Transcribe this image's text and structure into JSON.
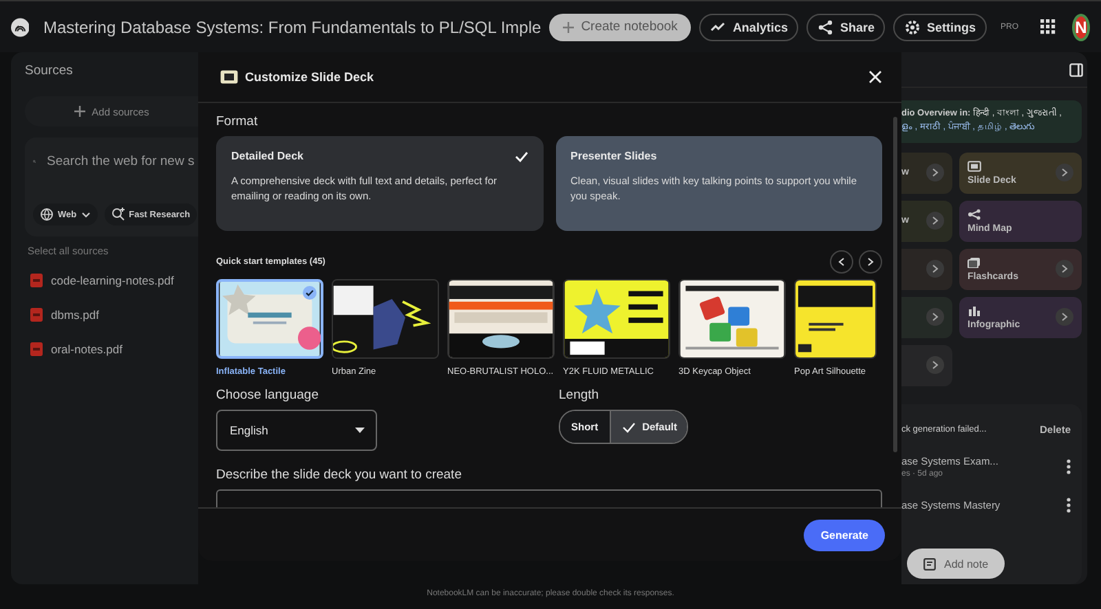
{
  "app_bar": {
    "title": "Mastering Database Systems: From Fundamentals to PL/SQL Imple",
    "create_button": "Create notebook",
    "actions": [
      {
        "label": "Analytics"
      },
      {
        "label": "Share"
      },
      {
        "label": "Settings"
      }
    ],
    "badge": "PRO",
    "avatar": "N"
  },
  "sources": {
    "title": "Sources",
    "add_button": "Add sources",
    "search": {
      "placeholder": "Search the web for new s"
    },
    "chips": [
      {
        "label": "Web"
      },
      {
        "label": "Fast Research"
      }
    ],
    "select_all": "Select all sources",
    "items": [
      {
        "name": "code-learning-notes.pdf"
      },
      {
        "name": "dbms.pdf"
      },
      {
        "name": "oral-notes.pdf"
      }
    ]
  },
  "dialog": {
    "title": "Customize Slide Deck",
    "format_label": "Format",
    "formats": [
      {
        "name": "Detailed Deck",
        "description": "A comprehensive deck with full text and details, perfect for emailing or reading on its own.",
        "selected": true
      },
      {
        "name": "Presenter Slides",
        "description": "Clean, visual slides with key talking points to support you while you speak.",
        "selected": false
      }
    ],
    "templates_label": "Quick start templates (45)",
    "templates": [
      {
        "name": "Inflatable Tactile",
        "selected": true
      },
      {
        "name": "Urban Zine",
        "selected": false
      },
      {
        "name": "NEO-BRUTALIST HOLO...",
        "selected": false
      },
      {
        "name": "Y2K FLUID METALLIC",
        "selected": false
      },
      {
        "name": "3D Keycap Object",
        "selected": false
      },
      {
        "name": "Pop Art Silhouette",
        "selected": false
      }
    ],
    "language": {
      "label": "Choose language",
      "value": "English"
    },
    "length": {
      "label": "Length",
      "options": [
        {
          "label": "Short",
          "selected": false
        },
        {
          "label": "Default",
          "selected": true
        }
      ]
    },
    "description": {
      "label": "Describe the slide deck you want to create"
    },
    "generate_button": "Generate"
  },
  "studio": {
    "banner": "dio Overview in:",
    "languages": [
      "हिन्दी , বাংলা , ગુજરાતી ,",
      "ളം , मराठी , ਪੰਜਾਬੀ , தமிழ் , తెలుగు"
    ],
    "tools": [
      {
        "label": "w",
        "arrow": true
      },
      {
        "label": "Slide Deck",
        "arrow": true
      },
      {
        "label": "w",
        "arrow": true
      },
      {
        "label": "Mind Map",
        "arrow": false
      },
      {
        "arrow": true
      },
      {
        "label": "Flashcards",
        "arrow": true
      },
      {
        "arrow": true
      },
      {
        "label": "Infographic",
        "arrow": true
      },
      {
        "arrow": true
      }
    ],
    "notes": [
      {
        "title": "ck generation failed...",
        "action": "Delete"
      },
      {
        "title": "ase Systems Exam...",
        "meta": "es · 5d ago"
      },
      {
        "title": "ase Systems Mastery"
      }
    ],
    "add_note": "Add note"
  },
  "footer": "NotebookLM can be inaccurate; please double check its responses."
}
